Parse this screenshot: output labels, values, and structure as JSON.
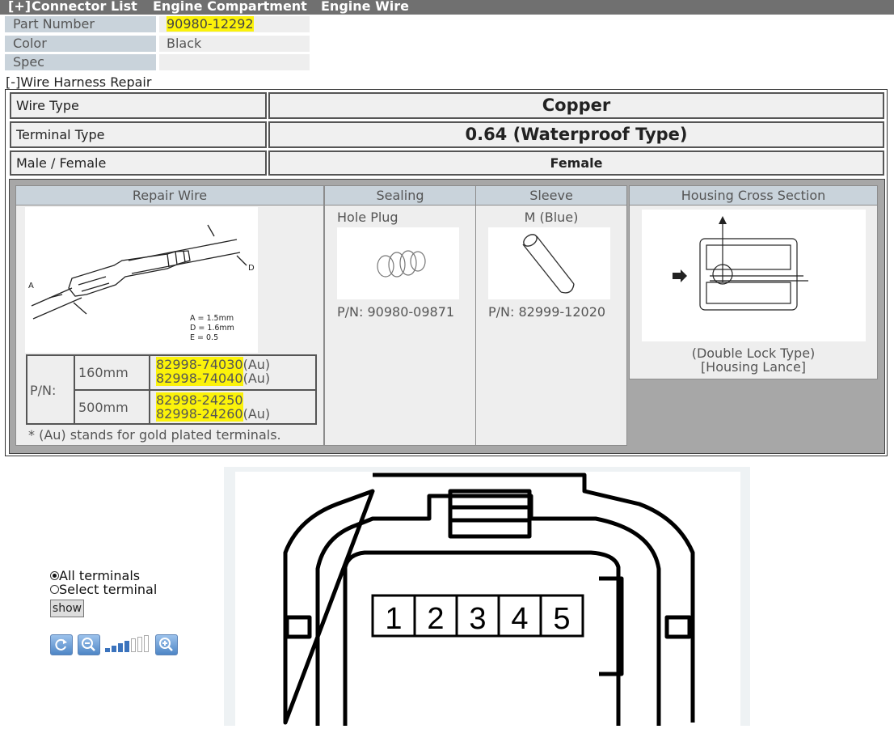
{
  "header": {
    "expander": "[+]",
    "connector_list": "Connector List",
    "location": "Engine Compartment",
    "harness": "Engine Wire"
  },
  "part_info": {
    "part_number_label": "Part Number",
    "part_number_value": "90980-12292",
    "color_label": "Color",
    "color_value": "Black",
    "spec_label": "Spec",
    "spec_value": ""
  },
  "repair": {
    "title": "[-]Wire Harness Repair",
    "wire_type_label": "Wire Type",
    "wire_type_value": "Copper",
    "terminal_type_label": "Terminal Type",
    "terminal_type_value": "0.64 (Waterproof Type)",
    "gender_label": "Male / Female",
    "gender_value": "Female"
  },
  "columns": {
    "repair_wire": "Repair Wire",
    "sealing": "Sealing",
    "sleeve": "Sleeve",
    "housing": "Housing Cross Section"
  },
  "repair_wire": {
    "dim_a_label": "A",
    "dim_d_label": "D",
    "dims": [
      "A = 1.5mm",
      "D = 1.6mm",
      "E = 0.5"
    ],
    "pn_label": "P/N:",
    "rows": [
      {
        "length": "160mm",
        "parts": [
          {
            "pn": "82998-74030",
            "suffix": "(Au)"
          },
          {
            "pn": "82998-74040",
            "suffix": "(Au)"
          }
        ]
      },
      {
        "length": "500mm",
        "parts": [
          {
            "pn": "82998-24250",
            "suffix": ""
          },
          {
            "pn": "82998-24260",
            "suffix": "(Au)"
          }
        ]
      }
    ],
    "note": "* (Au) stands for gold plated terminals."
  },
  "sealing": {
    "name": "Hole Plug",
    "pn": "P/N: 90980-09871"
  },
  "sleeve": {
    "name": "M (Blue)",
    "pn": "P/N: 82999-12020"
  },
  "housing": {
    "caption_line1": "(Double Lock Type)",
    "caption_line2": "[Housing Lance]"
  },
  "controls": {
    "all_terminals": "All terminals",
    "select_terminal": "Select terminal",
    "show_button": "show",
    "selected_option": "All terminals",
    "zoom_level_bars": "4 of 7"
  },
  "connector": {
    "pins": [
      "1",
      "2",
      "3",
      "4",
      "5"
    ]
  },
  "colors": {
    "highlight": "#fbf20a",
    "header_bar": "#707070",
    "label_cell": "#c9d3db"
  }
}
